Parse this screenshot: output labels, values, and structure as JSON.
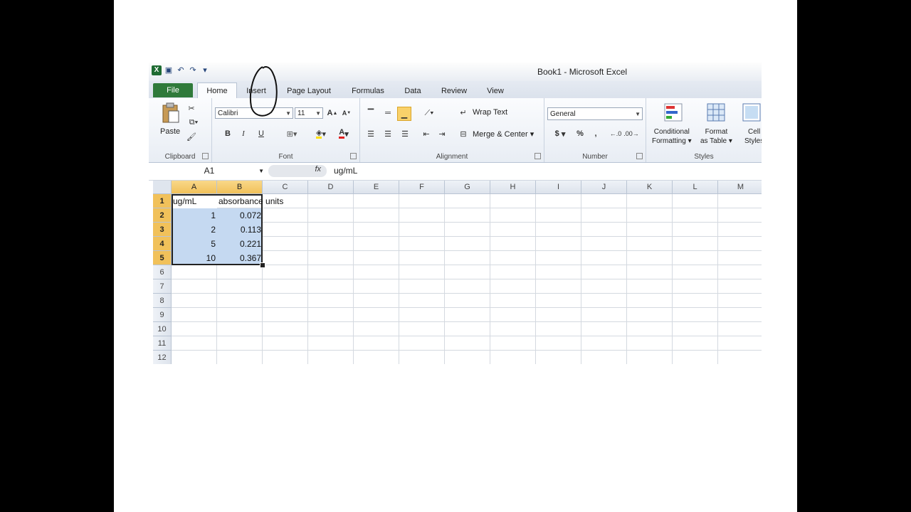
{
  "window": {
    "title": "Book1 - Microsoft Excel"
  },
  "tabs": [
    {
      "label": "File"
    },
    {
      "label": "Home"
    },
    {
      "label": "Insert"
    },
    {
      "label": "Page Layout"
    },
    {
      "label": "Formulas"
    },
    {
      "label": "Data"
    },
    {
      "label": "Review"
    },
    {
      "label": "View"
    }
  ],
  "ribbon": {
    "clipboard": {
      "label": "Clipboard",
      "paste": "Paste"
    },
    "font": {
      "label": "Font",
      "name": "Calibri",
      "size": "11",
      "bold": "B",
      "italic": "I",
      "underline": "U"
    },
    "alignment": {
      "label": "Alignment",
      "wrap_text": "Wrap Text",
      "merge_center": "Merge & Center"
    },
    "number": {
      "label": "Number",
      "format": "General",
      "currency": "$",
      "percent": "%",
      "comma": ","
    },
    "styles": {
      "label": "Styles",
      "conditional": "Conditional",
      "conditional2": "Formatting",
      "format_table": "Format",
      "format_table2": "as Table",
      "cell_styles": "Cell",
      "cell_styles2": "Styles"
    }
  },
  "formula_bar": {
    "name_box": "A1",
    "fx": "fx",
    "formula": "ug/mL"
  },
  "columns": [
    "A",
    "B",
    "C",
    "D",
    "E",
    "F",
    "G",
    "H",
    "I",
    "J",
    "K",
    "L",
    "M"
  ],
  "rows": [
    "1",
    "2",
    "3",
    "4",
    "5",
    "6",
    "7",
    "8",
    "9",
    "10",
    "11",
    "12"
  ],
  "sheet": {
    "headers": [
      "ug/mL",
      "absorbance units"
    ],
    "data": [
      {
        "a": "1",
        "b": "0.072"
      },
      {
        "a": "2",
        "b": "0.113"
      },
      {
        "a": "5",
        "b": "0.221"
      },
      {
        "a": "10",
        "b": "0.367"
      }
    ]
  },
  "colors": {
    "selection": "#c5d9f1",
    "file_tab": "#2f7a3a",
    "header_selected": "#f1c15a"
  }
}
